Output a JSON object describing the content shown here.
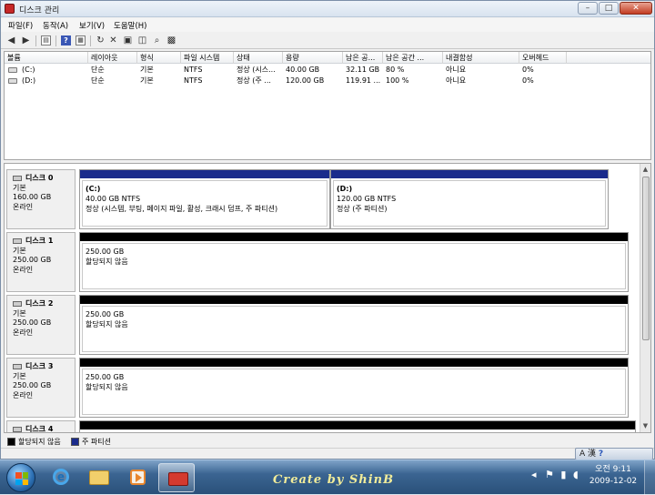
{
  "window": {
    "title": "디스크 관리"
  },
  "menu": [
    {
      "label": "파일(F)"
    },
    {
      "label": "동작(A)"
    },
    {
      "label": "보기(V)"
    },
    {
      "label": "도움말(H)"
    }
  ],
  "toolbar": {
    "icons": [
      "back-arrow-icon",
      "forward-arrow-icon",
      "console-tree-icon",
      "help-icon",
      "action-pane-icon",
      "refresh-icon",
      "delete-icon",
      "properties-icon",
      "open-icon",
      "explore-icon",
      "settings-icon"
    ]
  },
  "volumes": {
    "columns": [
      "볼륨",
      "레이아웃",
      "형식",
      "파일 시스템",
      "상태",
      "용량",
      "남은 공...",
      "남은 공간 ...",
      "내결함성",
      "오버헤드"
    ],
    "rows": [
      [
        "(C:)",
        "단순",
        "기본",
        "NTFS",
        "정상 (시스...",
        "40.00 GB",
        "32.11 GB",
        "80 %",
        "아니요",
        "0%"
      ],
      [
        "(D:)",
        "단순",
        "기본",
        "NTFS",
        "정상 (주 ...",
        "120.00 GB",
        "119.91 ...",
        "100 %",
        "아니요",
        "0%"
      ]
    ]
  },
  "disks": [
    {
      "name": "디스크 0",
      "type": "기본",
      "size": "160.00 GB",
      "status": "온라인",
      "partitions": [
        {
          "name": "(C:)",
          "size_fs": "40.00 GB NTFS",
          "status": "정상 (시스템, 부팅, 페이지 파일, 활성, 크래시 덤프, 주 파티션)",
          "kind": "primary"
        },
        {
          "name": "(D:)",
          "size_fs": "120.00 GB NTFS",
          "status": "정상 (주 파티션)",
          "kind": "primary"
        }
      ]
    },
    {
      "name": "디스크 1",
      "type": "기본",
      "size": "250.00 GB",
      "status": "온라인",
      "partitions": [
        {
          "size_fs": "250.00 GB",
          "status": "할당되지 않음",
          "kind": "unallocated"
        }
      ]
    },
    {
      "name": "디스크 2",
      "type": "기본",
      "size": "250.00 GB",
      "status": "온라인",
      "partitions": [
        {
          "size_fs": "250.00 GB",
          "status": "할당되지 않음",
          "kind": "unallocated"
        }
      ]
    },
    {
      "name": "디스크 3",
      "type": "기본",
      "size": "250.00 GB",
      "status": "온라인",
      "partitions": [
        {
          "size_fs": "250.00 GB",
          "status": "할당되지 않음",
          "kind": "unallocated"
        }
      ]
    },
    {
      "name": "디스크 4",
      "type": "기본",
      "size": "",
      "status": "",
      "partitions": []
    }
  ],
  "legend": [
    {
      "label": "할당되지 않음",
      "color": "#000000"
    },
    {
      "label": "주 파티션",
      "color": "#1a2b8c"
    }
  ],
  "taskbar": {
    "watermark": "Create by ShinB",
    "clock": {
      "time": "오전 9:11",
      "date": "2009-12-02"
    }
  },
  "langbar": {
    "text": "A 漢"
  },
  "colors": {
    "primary_partition": "#1a2b8c",
    "unallocated": "#000000",
    "taskbar": "#2a5079"
  }
}
